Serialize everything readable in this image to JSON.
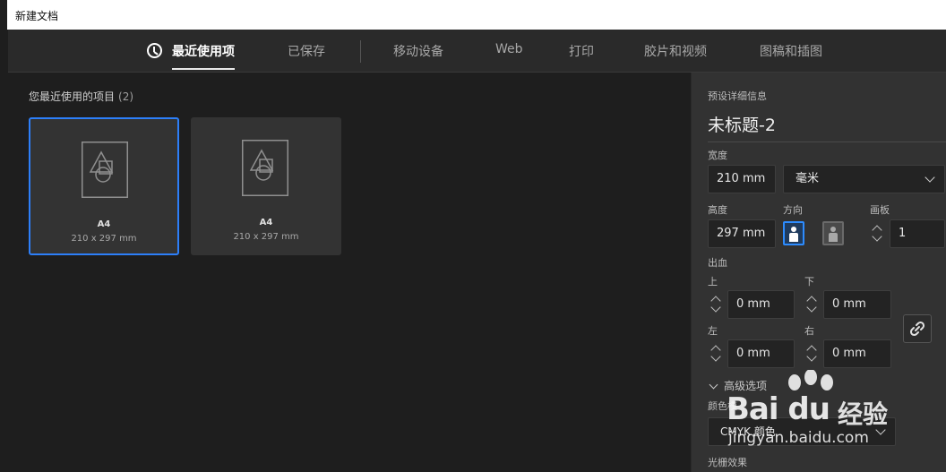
{
  "window": {
    "title": "新建文档"
  },
  "tabs": [
    {
      "label": "最近使用项",
      "active": true
    },
    {
      "label": "已保存"
    },
    {
      "label": "移动设备"
    },
    {
      "label": "Web"
    },
    {
      "label": "打印"
    },
    {
      "label": "胶片和视频"
    },
    {
      "label": "图稿和插图"
    }
  ],
  "recent": {
    "title": "您最近使用的项目",
    "count": "(2)",
    "items": [
      {
        "name": "A4",
        "size": "210 x 297 mm",
        "selected": true
      },
      {
        "name": "A4",
        "size": "210 x 297 mm",
        "selected": false
      }
    ]
  },
  "preset": {
    "heading": "预设详细信息",
    "doc_name": "未标题-2",
    "width_label": "宽度",
    "width_value": "210 mm",
    "unit": "毫米",
    "height_label": "高度",
    "height_value": "297 mm",
    "orientation_label": "方向",
    "artboard_label": "画板",
    "artboard_value": "1",
    "bleed_label": "出血",
    "top_label": "上",
    "top_value": "0 mm",
    "bottom_label": "下",
    "bottom_value": "0 mm",
    "left_label": "左",
    "left_value": "0 mm",
    "right_label": "右",
    "right_value": "0 mm",
    "advanced_label": "高级选项",
    "color_mode_label": "颜色模",
    "color_mode_value": "CMYK 颜色",
    "raster_label": "光栅效果"
  },
  "colors": {
    "accent": "#2d7ff9",
    "panel": "#323232",
    "background": "#1e1e1e"
  },
  "watermark": {
    "brand": "Bai du",
    "cn": "经验",
    "url": "jingyan.baidu.com"
  }
}
